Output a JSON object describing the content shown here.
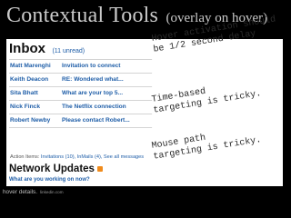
{
  "slide": {
    "title": "Contextual Tools",
    "subtitle": "(overlay on hover)",
    "footer": "hover details.",
    "footer_source": "linkedin.com"
  },
  "inbox": {
    "title": "Inbox",
    "unread": "(11 unread)",
    "rows": [
      {
        "from": "Matt Marenghi",
        "subject": "Invitation to connect"
      },
      {
        "from": "Keith Deacon",
        "subject": "RE: Wondered what..."
      },
      {
        "from": "Sita Bhatt",
        "subject": "What are your top 5..."
      },
      {
        "from": "Nick Finck",
        "subject": "The Netflix connection"
      },
      {
        "from": "Robert Newby",
        "subject": "Please contact Robert..."
      }
    ],
    "actions_label": "Action Items:",
    "actions_links": "Invitations (10), InMails (4), See all messages"
  },
  "network": {
    "title": "Network Updates",
    "prompt": "What are you working on now?"
  },
  "notes": [
    {
      "lines": [
        "Hover activation should",
        "be 1/2 second delay"
      ]
    },
    {
      "lines": [
        "Time-based",
        "targeting is tricky."
      ]
    },
    {
      "lines": [
        "Mouse path",
        "targeting is tricky."
      ]
    }
  ]
}
